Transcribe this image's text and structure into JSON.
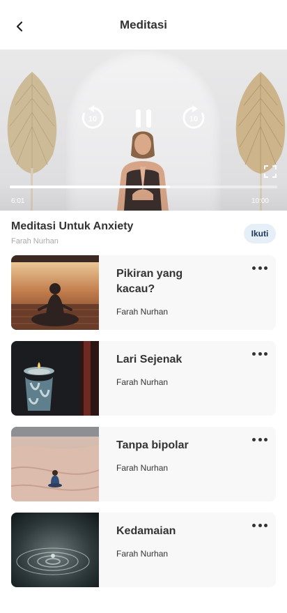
{
  "header": {
    "title": "Meditasi",
    "back_icon": "back-chevron-icon"
  },
  "player": {
    "current_time": "6:01",
    "duration": "10:00",
    "progress_fraction": 0.6,
    "rewind_label": "10",
    "forward_label": "10",
    "icons": {
      "rewind": "rewind-10-icon",
      "pause": "pause-icon",
      "forward": "forward-10-icon",
      "fullscreen": "fullscreen-icon"
    }
  },
  "session": {
    "title": "Meditasi Untuk Anxiety",
    "author": "Farah Nurhan",
    "follow_label": "Ikuti"
  },
  "items": [
    {
      "title": "Pikiran yang kacau?",
      "author": "Farah Nurhan",
      "thumb": "meditation-sunset"
    },
    {
      "title": "Lari Sejenak",
      "author": "Farah Nurhan",
      "thumb": "oil-burner"
    },
    {
      "title": "Tanpa bipolar",
      "author": "Farah Nurhan",
      "thumb": "desert-sitting"
    },
    {
      "title": "Kedamaian",
      "author": "Farah Nurhan",
      "thumb": "water-ripple"
    }
  ],
  "colors": {
    "accent_badge_bg": "#e6eef8",
    "accent_badge_text": "#1e3556",
    "card_bg": "#f8f8f8"
  }
}
